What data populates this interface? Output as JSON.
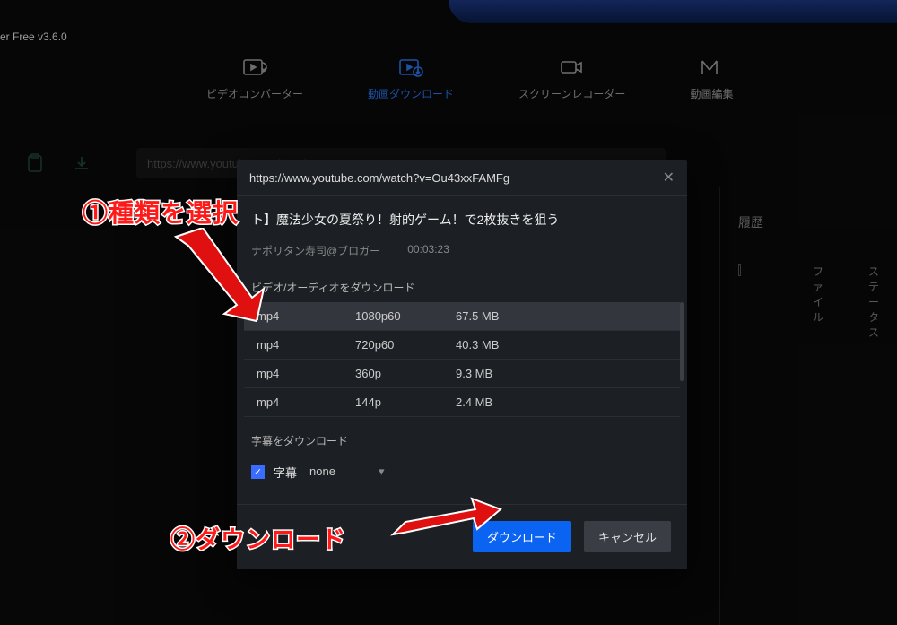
{
  "app_title": "er Free v3.6.0",
  "tabs": {
    "converter": "ビデオコンバーター",
    "download": "動画ダウンロード",
    "recorder": "スクリーンレコーダー",
    "editor": "動画編集"
  },
  "url_input_value": "https://www.youtube.com/watch?v=Ou43xxFAMFg",
  "history": {
    "title": "履歴",
    "col_file": "ファイル",
    "col_status": "ステータス"
  },
  "modal": {
    "url": "https://www.youtube.com/watch?v=Ou43xxFAMFg",
    "video_title": "ト】魔法少女の夏祭り！射的ゲーム！で2枚抜きを狙う",
    "author": "ナポリタン寿司@ブロガー",
    "duration": "00:03:23",
    "section_download": "ビデオ/オーディオをダウンロード",
    "section_subtitle": "字幕をダウンロード",
    "subtitle_label": "字幕",
    "subtitle_value": "none",
    "download_btn": "ダウンロード",
    "cancel_btn": "キャンセル",
    "options": [
      {
        "fmt": "mp4",
        "res": "1080p60",
        "size": "67.5 MB",
        "selected": true
      },
      {
        "fmt": "mp4",
        "res": "720p60",
        "size": "40.3 MB",
        "selected": false
      },
      {
        "fmt": "mp4",
        "res": "360p",
        "size": "9.3 MB",
        "selected": false
      },
      {
        "fmt": "mp4",
        "res": "144p",
        "size": "2.4 MB",
        "selected": false
      }
    ]
  },
  "annotations": {
    "step1": "①種類を選択",
    "step2": "②ダウンロード"
  }
}
